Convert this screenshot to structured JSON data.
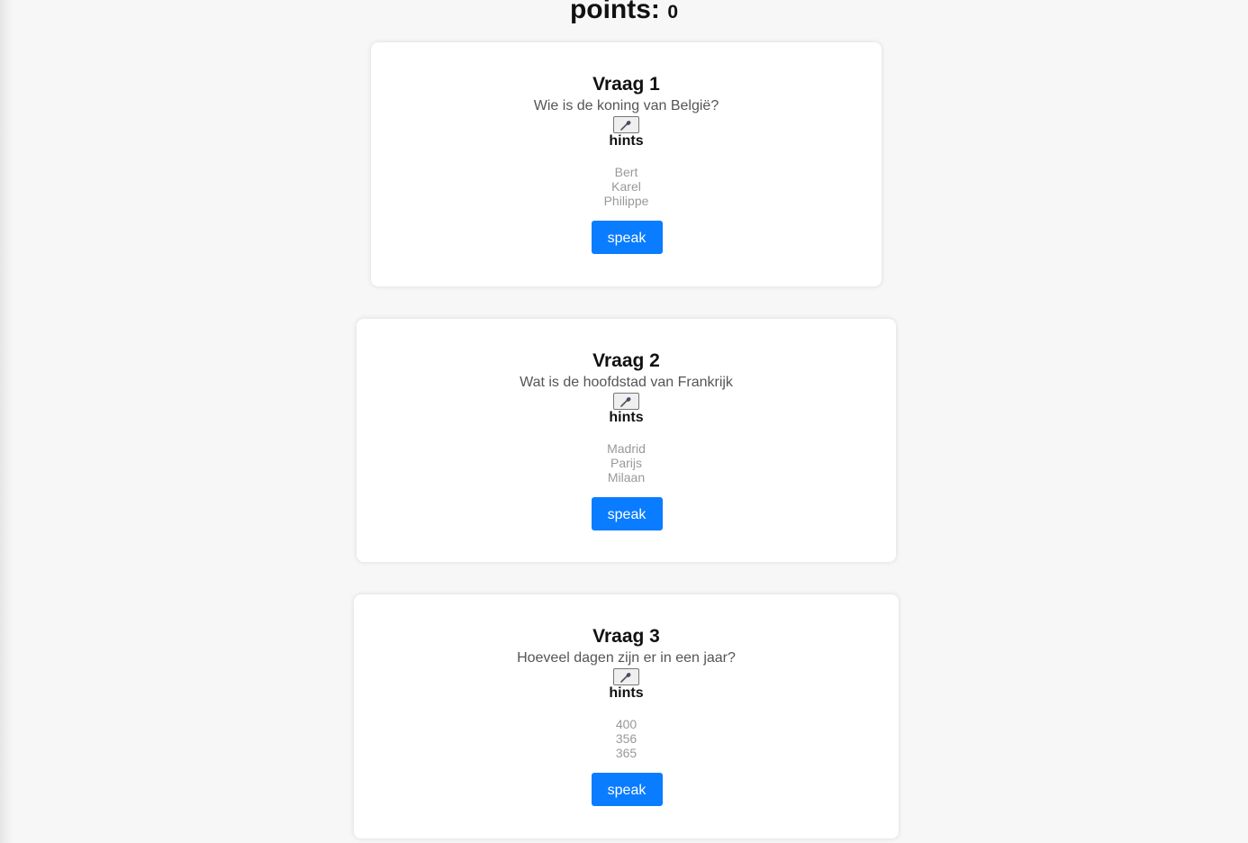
{
  "header": {
    "points_label": "points:",
    "points_value": "0"
  },
  "questions": [
    {
      "title": "Vraag 1",
      "question": "Wie is de koning van België?",
      "mic_icon": "microphone-icon",
      "hints_label": "hints",
      "hints": [
        "Bert",
        "Karel",
        "Philippe"
      ],
      "speak_label": "speak"
    },
    {
      "title": "Vraag 2",
      "question": "Wat is de hoofdstad van Frankrijk",
      "mic_icon": "microphone-icon",
      "hints_label": "hints",
      "hints": [
        "Madrid",
        "Parijs",
        "Milaan"
      ],
      "speak_label": "speak"
    },
    {
      "title": "Vraag 3",
      "question": "Hoeveel dagen zijn er in een jaar?",
      "mic_icon": "microphone-icon",
      "hints_label": "hints",
      "hints": [
        "400",
        "356",
        "365"
      ],
      "speak_label": "speak"
    }
  ],
  "colors": {
    "speak_button": "#0a7cff",
    "background": "#f7f7f7"
  }
}
